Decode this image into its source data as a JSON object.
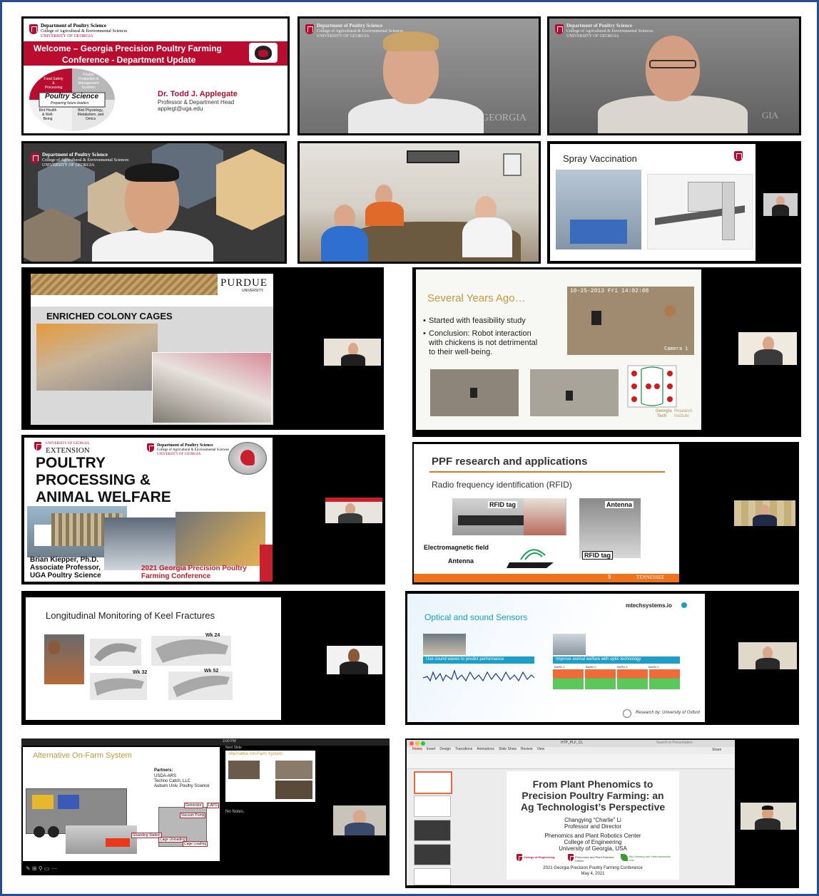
{
  "colors": {
    "uga_red": "#ba0c2f",
    "frame_blue": "#2a4d8f",
    "purdue_gold": "#c4a26a",
    "orange": "#f0721a",
    "teal": "#1a9fc8"
  },
  "t1": {
    "dept": "Department of Poultry Science",
    "college": "College of Agricultural & Environmental Sciences",
    "uni": "UNIVERSITY OF GEORGIA",
    "banner_line1": "Welcome – Georgia Precision Poultry Farming",
    "banner_line2": "Conference - Department Update",
    "wheel_food": "Food Safety & Processing",
    "wheel_prod": "Poultry Production & Management Systems",
    "wheel_health": "Bird Health & Well-Being",
    "wheel_phys": "Bird Physiology, Metabolism, and Omics",
    "wheel_center": "Poultry Science",
    "wheel_tag": "Preparing future leaders",
    "speaker": "Dr. Todd J. Applegate",
    "role": "Professor & Department Head",
    "email": "applegt@uga.edu"
  },
  "t2": {
    "dept": "Department of Poultry Science",
    "college": "College of Agricultural & Environmental Sciences",
    "uni": "UNIVERSITY OF GEORGIA",
    "watermark": "GEORGIA"
  },
  "t3": {
    "dept": "Department of Poultry Science",
    "college": "College of Agricultural & Environmental Sciences",
    "uni": "UNIVERSITY OF GEORGIA",
    "watermark": "GIA"
  },
  "t4": {
    "dept": "Department of Poultry Science",
    "college": "College of Agricultural & Environmental Sciences",
    "uni": "UNIVERSITY OF GEORGIA"
  },
  "t6": {
    "title": "Spray Vaccination"
  },
  "t7": {
    "brand": "PURDUE",
    "brand_sub": "UNIVERSITY.",
    "title": "ENRICHED COLONY CAGES"
  },
  "t8": {
    "title": "Several Years Ago…",
    "bullet1": "Started with feasibility study",
    "bullet2_l1": "Conclusion:  Robot interaction",
    "bullet2_l2": "with chickens is not detrimental",
    "bullet2_l3": "to their well-being.",
    "timestamp": "10-25-2013 Fri 14:02:08",
    "camera": "Camera 1",
    "gt1": "Georgia",
    "gt2": "Tech",
    "gt3": "Research",
    "gt4": "Institute"
  },
  "t9": {
    "ext_uni": "UNIVERSITY OF GEORGIA",
    "ext": "EXTENSION",
    "dept": "Department of Poultry Science",
    "college": "College of Agricultural & Environmental Sciences",
    "uni": "UNIVERSITY OF GEORGIA",
    "title_l1": "POULTRY",
    "title_l2": "PROCESSING &",
    "title_l3": "ANIMAL WELFARE",
    "name": "Brian Kiepper, Ph.D.",
    "role": "Associate Professor,",
    "dept2": "UGA Poultry Science",
    "conf_l1": "2021 Georgia Precision Poultry",
    "conf_l2": "Farming Conference"
  },
  "t10": {
    "title": "PPF research and applications",
    "subtitle": "Radio frequency identification (RFID)",
    "rfid_tag": "RFID tag",
    "antenna_top": "Antenna",
    "em_field": "Electromagnetic field",
    "antenna_bottom": "Antenna",
    "rfid_tag2": "RFID tag",
    "page": "9",
    "footer_brand": "TENNESSEE"
  },
  "t11": {
    "title": "Longitudinal Monitoring of Keel Fractures",
    "wk24": "Wk 24",
    "wk32": "Wk 32",
    "wk52": "Wk 52"
  },
  "t12": {
    "title": "Optical and sound Sensors",
    "site": "mtechsystems.io",
    "bar1": "Use sound waves to predict performance",
    "bar2": "Improve animal welfare with optic technology",
    "barn1": "BARN 1",
    "barn2": "BARN 2",
    "barn3": "BARN 3",
    "barn4": "BARN 4",
    "credit": "Research by: University of Oxford"
  },
  "t13": {
    "title": "Alternative On-Farm System",
    "partners": "Partners:",
    "p1": "USDA-ARS",
    "p2": "Techno Catch, LLC",
    "p3": "Auburn Univ. Poultry Science",
    "generator": "Generator",
    "lapd": "LAPD",
    "vacuum": "Vacuum Pump",
    "shackling": "Shackling Station",
    "unloading": "Cage Unloading",
    "loading": "Cage Loading",
    "next": "Next Slide",
    "next_title": "Alternative On-Farm System",
    "notes": "No Notes.",
    "time": "3:00 PM"
  },
  "t14": {
    "menu": [
      "Home",
      "Insert",
      "Design",
      "Transitions",
      "Animations",
      "Slide Show",
      "Review",
      "View"
    ],
    "share": "Share",
    "file": "HTP_PLF_CL",
    "search": "Search in Presentation",
    "title_l1": "From Plant Phenomics to",
    "title_l2": "Precision Poultry Farming: an",
    "title_l3": "Ag Technologist’s Perspective",
    "name": "Changying “Charlie” Li",
    "role": "Professor and Director",
    "center": "Phenomics and Plant Robotics Center",
    "college": "College of Engineering",
    "uni": "University of Georgia, USA",
    "logo1": "College of Engineering",
    "logo2": "Phenomics and Plant Robotics Center",
    "logo3": "Bio-Sensing and Instrumentation Lab",
    "conf": "2021 Georgia Precision Poultry Farming Conference",
    "date": "May 4, 2021"
  }
}
